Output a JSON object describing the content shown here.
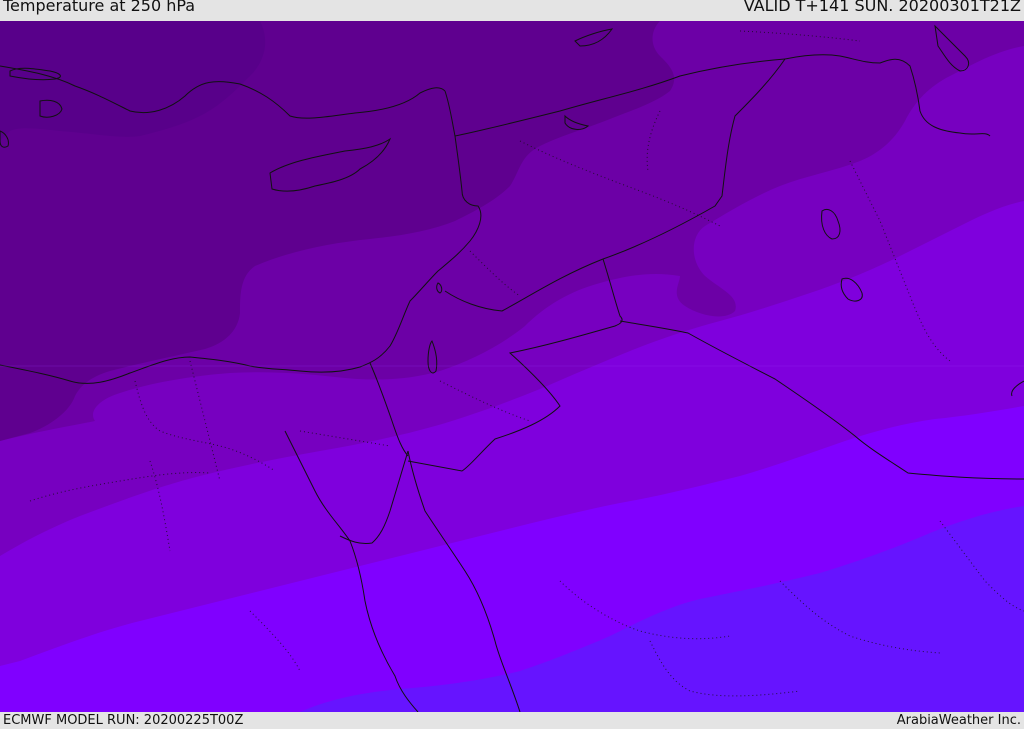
{
  "header": {
    "title": "Temperature at 250 hPa",
    "valid": "VALID T+141 SUN. 20200301T21Z"
  },
  "footer": {
    "model_run": "ECMWF MODEL RUN: 20200225T00Z",
    "brand": "ArabiaWeather Inc."
  },
  "colors": {
    "band_coldest": "#5f008f",
    "band_2": "#6c00a6",
    "band_3": "#7700c0",
    "band_4": "#7f00dd",
    "band_5": "#8000ff",
    "band_warmest": "#6614ff",
    "borders": "#111111"
  }
}
